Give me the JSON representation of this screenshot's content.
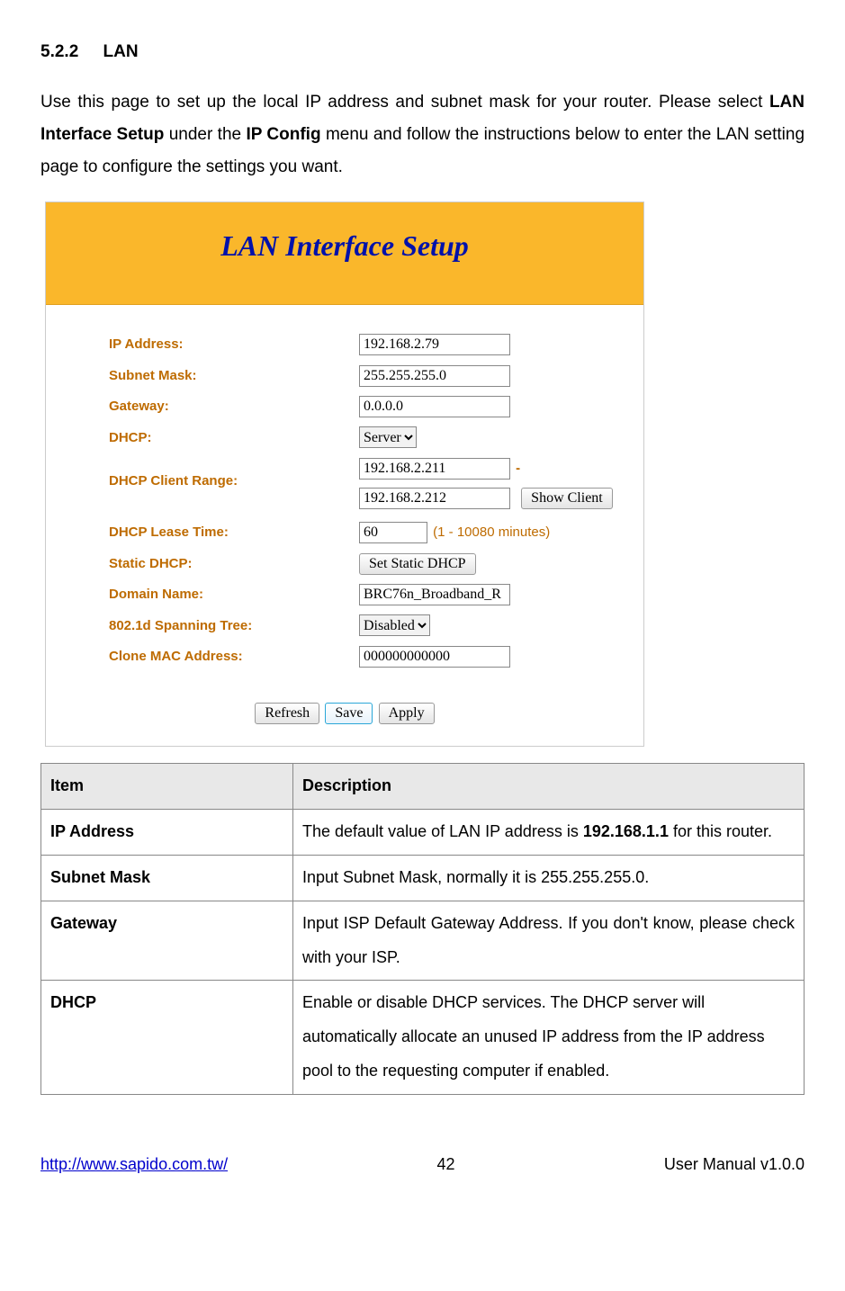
{
  "heading": {
    "num": "5.2.2",
    "title": "LAN"
  },
  "intro": {
    "p1a": "Use this page to set up the local IP address and subnet mask for your router. Please select ",
    "b1": "LAN Interface Setup",
    "p1b": " under the ",
    "b2": "IP Config",
    "p1c": " menu and follow the instructions below to enter the LAN setting page to configure the settings you want."
  },
  "screenshot": {
    "title": "LAN Interface Setup",
    "labels": {
      "ip": "IP Address:",
      "subnet": "Subnet Mask:",
      "gateway": "Gateway:",
      "dhcp": "DHCP:",
      "range": "DHCP Client Range:",
      "lease": "DHCP Lease Time:",
      "static": "Static DHCP:",
      "domain": "Domain Name:",
      "spanning": "802.1d Spanning Tree:",
      "clone": "Clone MAC Address:"
    },
    "values": {
      "ip": "192.168.2.79",
      "subnet": "255.255.255.0",
      "gateway": "0.0.0.0",
      "dhcp": "Server",
      "range1": "192.168.2.211",
      "range_dash": "-",
      "range2": "192.168.2.212",
      "lease": "60",
      "lease_hint": "(1 - 10080 minutes)",
      "domain": "BRC76n_Broadband_R",
      "spanning": "Disabled",
      "clone": "000000000000"
    },
    "buttons": {
      "show_client": "Show Client",
      "set_static": "Set Static DHCP",
      "refresh": "Refresh",
      "save": "Save",
      "apply": "Apply"
    }
  },
  "table": {
    "headers": {
      "item": "Item",
      "desc": "Description"
    },
    "rows": [
      {
        "item": "IP Address",
        "desc_a": "The default value of LAN IP address is ",
        "desc_b": "192.168.1.1",
        "desc_c": " for this router."
      },
      {
        "item": "Subnet Mask",
        "desc_a": "Input Subnet Mask, normally it is 255.255.255.0.",
        "desc_b": "",
        "desc_c": ""
      },
      {
        "item": "Gateway",
        "desc_a": "Input ISP Default Gateway Address. If you don't know, please check with your ISP.",
        "desc_b": "",
        "desc_c": ""
      },
      {
        "item": "DHCP",
        "desc_a": "Enable or disable DHCP services. The DHCP server will automatically allocate an unused IP address from the IP address pool to the requesting computer if enabled.",
        "desc_b": "",
        "desc_c": ""
      }
    ]
  },
  "footer": {
    "url": "http://www.sapido.com.tw/",
    "page": "42",
    "version": "User Manual v1.0.0"
  }
}
